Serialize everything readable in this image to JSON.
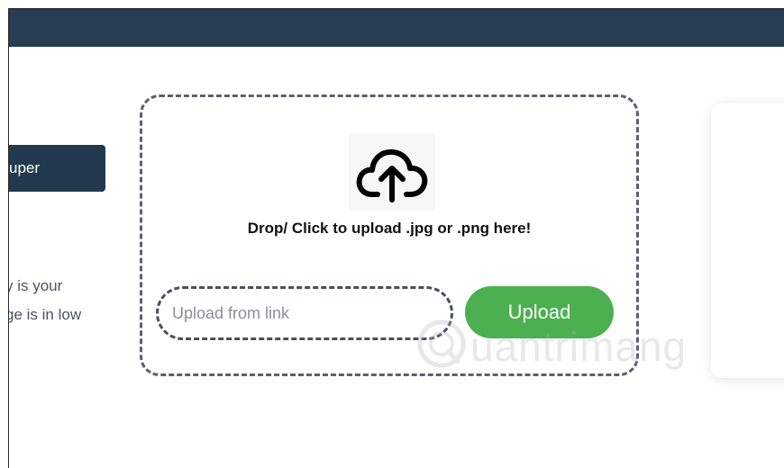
{
  "sidebar": {
    "button_label": "uper",
    "text_line1": "y is your",
    "text_line2": "ge is in low"
  },
  "dropzone": {
    "icon": "cloud-upload-icon",
    "label": "Drop/ Click to upload .jpg or .png here!",
    "link_placeholder": "Upload from link",
    "link_value": "",
    "upload_label": "Upload"
  },
  "watermark": {
    "text": "uantrimang"
  },
  "colors": {
    "header": "#263d52",
    "side_button": "#233a4e",
    "upload_button": "#4caf50",
    "dashed_border": "#5a6270"
  }
}
